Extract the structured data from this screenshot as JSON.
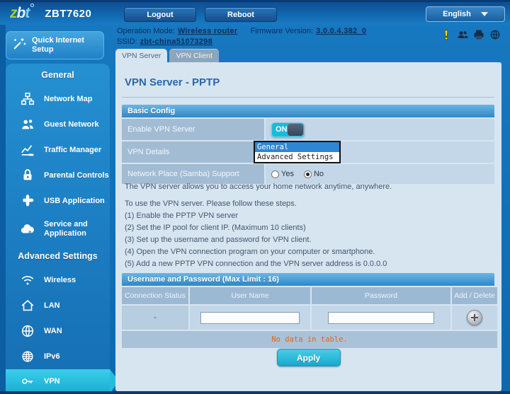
{
  "header": {
    "logo": {
      "z": "z",
      "b": "b",
      "t": "t"
    },
    "model": "ZBT7620",
    "logout": "Logout",
    "reboot": "Reboot",
    "language": "English",
    "operation_mode_label": "Operation Mode:",
    "operation_mode_value": "Wireless router",
    "firmware_label": "Firmware Version:",
    "firmware_value": "3.0.0.4.382_0",
    "ssid_label": "SSID:",
    "ssid_value": "zbt-china51073298"
  },
  "sidebar": {
    "quick_setup": "Quick Internet Setup",
    "general_title": "General",
    "advanced_title": "Advanced Settings",
    "items": {
      "network_map": "Network Map",
      "guest_network": "Guest Network",
      "traffic_manager": "Traffic Manager",
      "parental_controls": "Parental Controls",
      "usb_application": "USB Application",
      "service_application": "Service and Application",
      "wireless": "Wireless",
      "lan": "LAN",
      "wan": "WAN",
      "ipv6": "IPv6",
      "vpn": "VPN"
    },
    "active_item": "VPN"
  },
  "tabs": {
    "server": "VPN Server",
    "client": "VPN Client"
  },
  "page": {
    "title": "VPN Server - PPTP"
  },
  "basic_config": {
    "title": "Basic Config",
    "enable_label": "Enable VPN Server",
    "toggle_state": "ON",
    "details_label": "VPN Details",
    "details_options": {
      "general": "General",
      "advanced": "Advanced Settings"
    },
    "details_selected": "General",
    "samba_label": "Network Place (Samba) Support",
    "radio_yes": "Yes",
    "radio_no": "No",
    "samba_selected": "No"
  },
  "description": {
    "intro": "The VPN server allows you to access your home network anytime, anywhere.",
    "follow": "To use the VPN server. Please follow these steps.",
    "step1": "(1) Enable the PPTP VPN server",
    "step2": "(2) Set the IP pool for client IP. (Maximum 10 clients)",
    "step3": "(3) Set up the username and password for VPN client.",
    "step4": "(4) Open the VPN connection program on your computer or smartphone.",
    "step5": "(5) Add a new PPTP VPN connection and the VPN server address is 0.0.0.0"
  },
  "user_table": {
    "title": "Username and Password (Max Limit : 16)",
    "columns": {
      "status": "Connection Status",
      "username": "User Name",
      "password": "Password",
      "add": "Add / Delete"
    },
    "row": {
      "status": "-",
      "username": "",
      "password": ""
    },
    "empty_text": "No data in table."
  },
  "actions": {
    "apply": "Apply"
  },
  "colors": {
    "accent_cyan": "#1db4d6",
    "active_option_blue": "#2f86d4",
    "warning_orange": "#e2661f",
    "panel_blue": "#d7e5f1",
    "main_blue": "#1171b7"
  }
}
